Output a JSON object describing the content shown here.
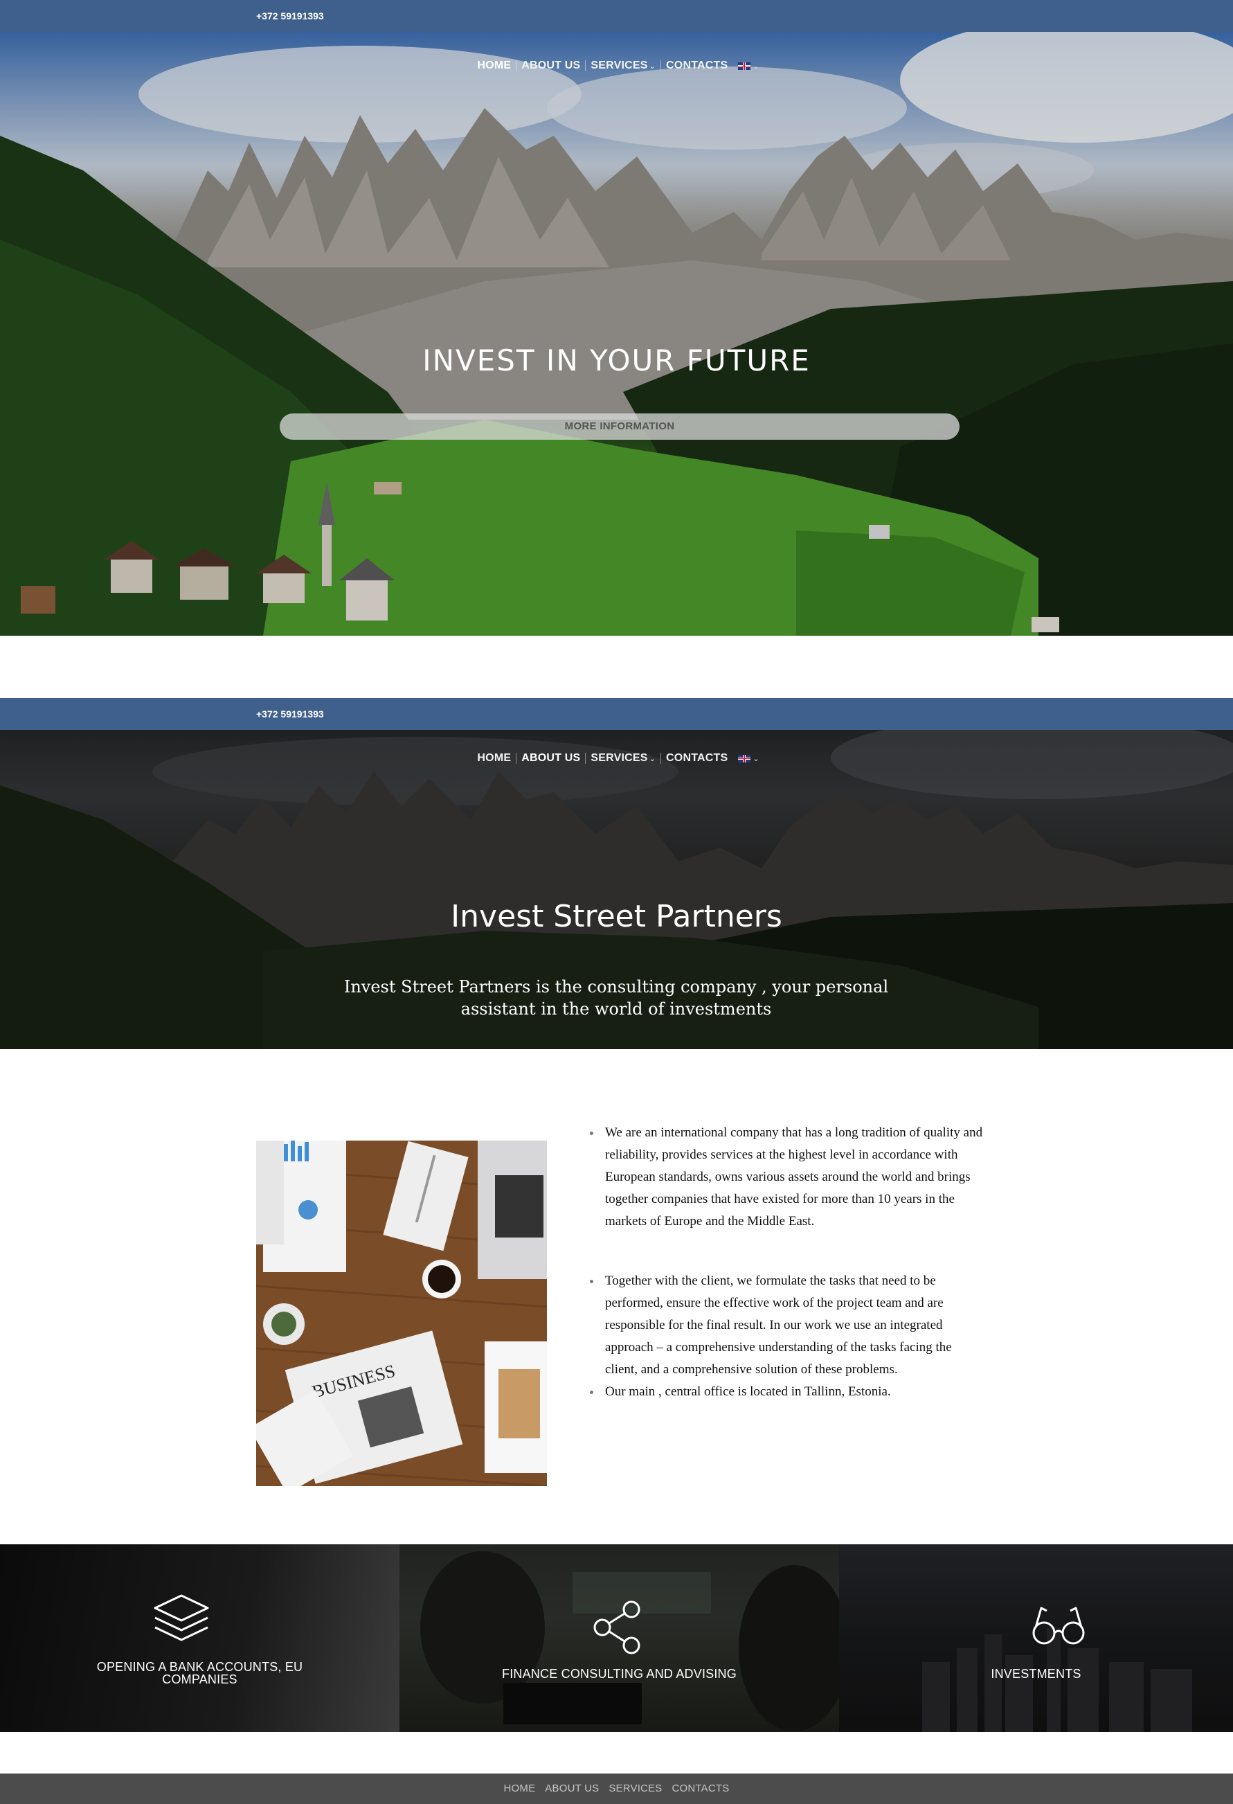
{
  "topbar": {
    "phone": "+372 59191393"
  },
  "nav": {
    "items": [
      {
        "label": "HOME"
      },
      {
        "label": "ABOUT US"
      },
      {
        "label": "SERVICES"
      },
      {
        "label": "CONTACTS"
      }
    ],
    "language_icon": "uk-flag-icon"
  },
  "hero": {
    "title": "INVEST IN YOUR FUTURE",
    "button": "MORE INFORMATION"
  },
  "about_hero": {
    "title": "Invest Street Partners",
    "subtitle": "Invest Street Partners is the consulting company , your personal assistant in the world of investments"
  },
  "about": {
    "paragraphs": [
      "We are an international company that has a long tradition of quality and reliability, provides services at the highest level in accordance with European standards, owns various assets around the world and brings together companies that have existed for more than 10 years in the markets of Europe and the Middle East.",
      "Together with the client, we formulate the tasks that need to be performed, ensure the effective work of the project team and are responsible for the final result. In our work we use an integrated approach – a comprehensive understanding of the tasks facing the client, and a comprehensive solution of these problems.",
      "Our main , central office is located in Tallinn, Estonia."
    ]
  },
  "services": [
    {
      "label": "OPENING A BANK ACCOUNTS, EU COMPANIES",
      "icon": "layers-icon"
    },
    {
      "label": "FINANCE CONSULTING AND ADVISING",
      "icon": "share-nodes-icon"
    },
    {
      "label": "INVESTMENTS",
      "icon": "glasses-icon"
    }
  ],
  "footer": {
    "items": [
      {
        "label": "HOME"
      },
      {
        "label": "ABOUT US"
      },
      {
        "label": "SERVICES"
      },
      {
        "label": "CONTACTS"
      }
    ]
  }
}
